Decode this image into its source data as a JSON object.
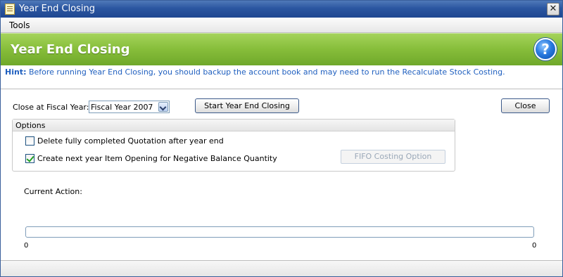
{
  "window": {
    "title": "Year End Closing",
    "close_glyph": "✕",
    "app_icon": "document-icon"
  },
  "menu": {
    "items": [
      "Tools"
    ]
  },
  "banner": {
    "title": "Year End Closing",
    "help_glyph": "?",
    "help_icon": "help-icon",
    "accent_color": "#86bd3a"
  },
  "hint": {
    "label": "Hint:",
    "text": "Before running Year End Closing, you should backup the account book and may need to run the Recalculate Stock Costing."
  },
  "form": {
    "fiscal_year_label": "Close at Fiscal Year:",
    "fiscal_year_value": "Fiscal Year 2007",
    "start_button": "Start Year End Closing",
    "close_button": "Close"
  },
  "options": {
    "title": "Options",
    "delete_quotation": {
      "label": "Delete fully completed Quotation after year end",
      "checked": false
    },
    "create_opening": {
      "label": "Create next year Item Opening for Negative Balance Quantity",
      "checked": true
    },
    "fifo_button": "FIFO Costing Option"
  },
  "progress": {
    "action_label": "Current Action:",
    "value": 0,
    "min_label": "0",
    "max_label": "0"
  }
}
